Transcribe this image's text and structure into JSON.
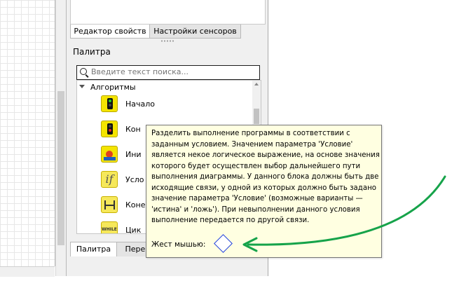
{
  "tabs_top": [
    {
      "label": "Редактор свойств",
      "active": true
    },
    {
      "label": "Настройки сенсоров",
      "active": false
    }
  ],
  "palette": {
    "title": "Палитра",
    "search_placeholder": "Введите текст поиска...",
    "group": "Алгоритмы",
    "items": [
      {
        "label": "Начало",
        "icon": "traffic-light-green-icon"
      },
      {
        "label": "Кон",
        "icon": "traffic-light-red-icon"
      },
      {
        "label": "Ини",
        "icon": "initialization-icon"
      },
      {
        "label": "Усло",
        "icon": "condition-if-icon"
      },
      {
        "label": "Коне",
        "icon": "end-if-icon"
      },
      {
        "label": "Цик",
        "icon": "while-loop-icon"
      }
    ],
    "while_text": "WHILE",
    "if_text": "if"
  },
  "tabs_bottom": [
    {
      "label": "Палитра",
      "active": true
    },
    {
      "label": "Перем",
      "active": false
    }
  ],
  "tooltip": {
    "description": "Разделить выполнение программы в соответствии с заданным условием. Значением параметра 'Условие' является некое логическое выражение, на основе значения которого будет осуществлен выбор дальнейшего пути выполнения диаграммы. У данного блока должны быть две исходящие связи, у одной из которых должно быть задано значение параметра 'Условие' (возможные варианты — 'истина' и 'ложь'). При невыполнении данного условия выполнение передается по другой связи.",
    "gesture_label": "Жест мышью:"
  },
  "colors": {
    "tooltip_bg": "#ffffe1",
    "arrow": "#16a34a",
    "gesture_diamond": "#1a3cd8",
    "icon_yellow": "#f4e400"
  }
}
